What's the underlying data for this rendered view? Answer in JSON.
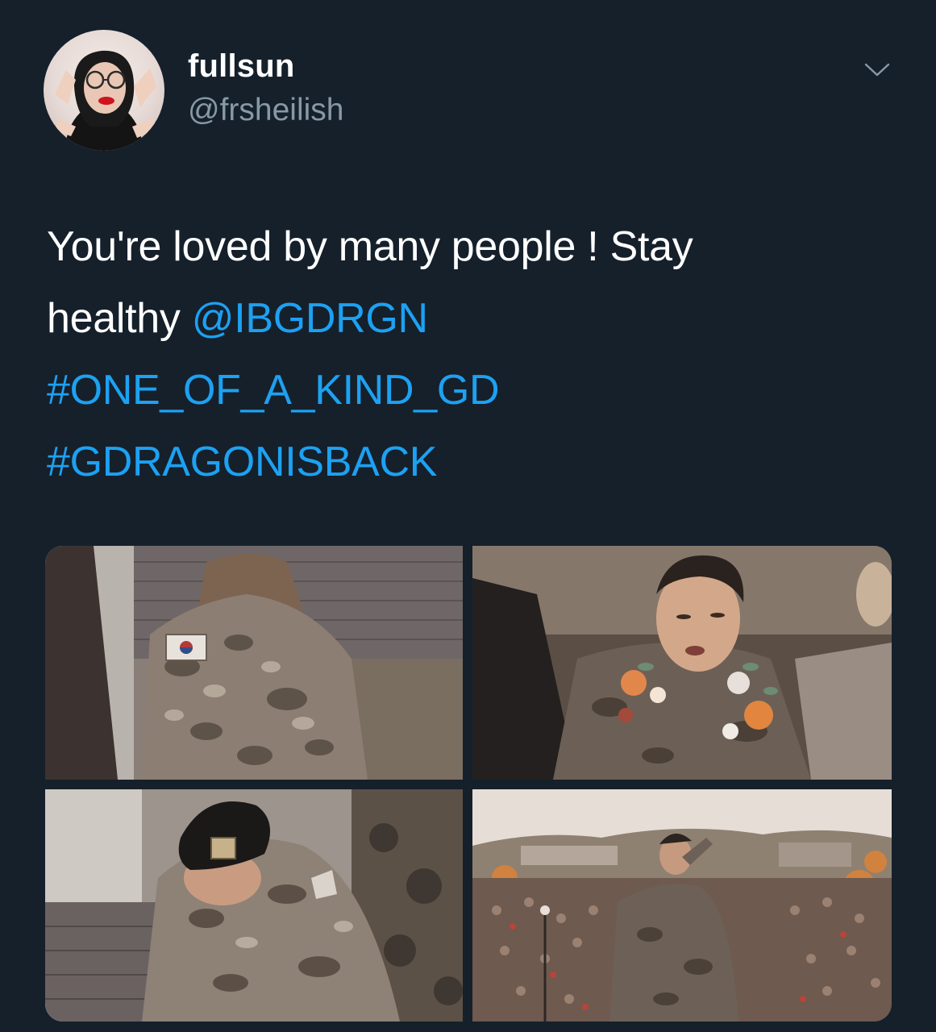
{
  "user": {
    "display_name": "fullsun",
    "handle": "@frsheilish",
    "avatar_icon": "avatar-photo"
  },
  "menu": {
    "icon": "chevron-down-icon"
  },
  "tweet": {
    "text_part1": "You're loved by many people ! Stay",
    "text_part2": "healthy ",
    "mention": "@IBGDRGN",
    "hashtag1": "#ONE_OF_A_KIND_GD",
    "hashtag2": "#GDRAGONISBACK"
  },
  "media": [
    {
      "name": "photo-uniform-shoulder"
    },
    {
      "name": "photo-flower-necklace"
    },
    {
      "name": "photo-bowing-soldier"
    },
    {
      "name": "photo-saluting-crowd"
    }
  ],
  "colors": {
    "background": "#15202b",
    "link": "#1da1f2",
    "secondary_text": "#8899a6",
    "primary_text": "#ffffff"
  }
}
